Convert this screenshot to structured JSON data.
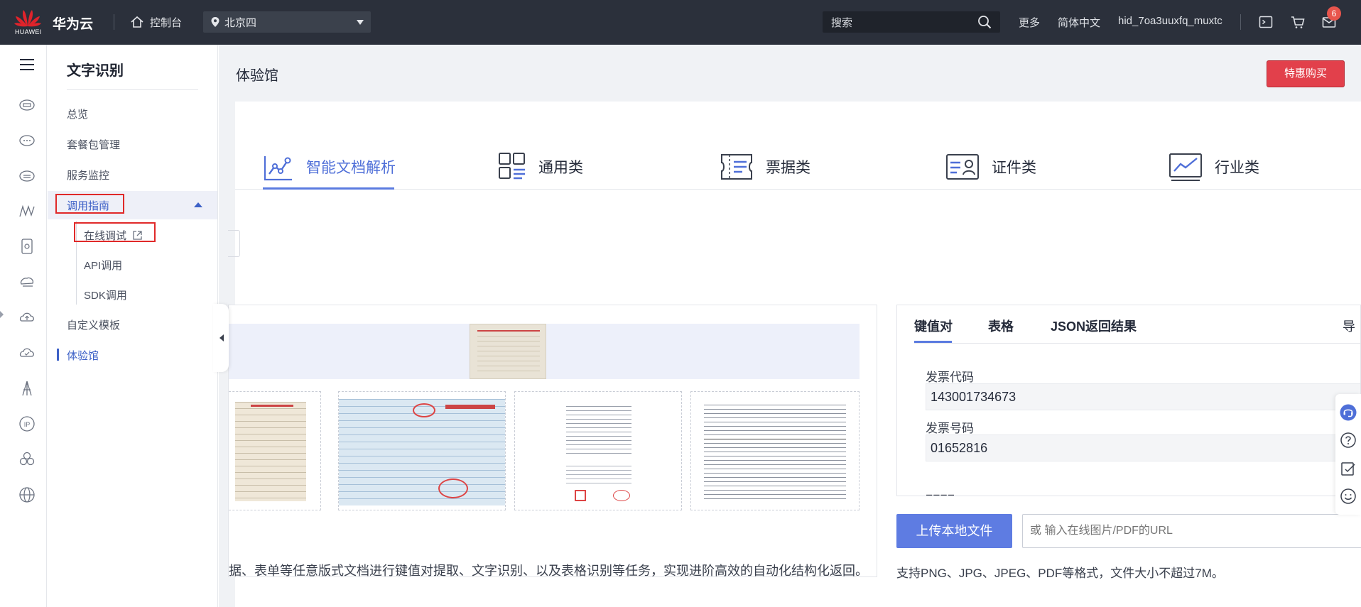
{
  "topbar": {
    "logo_text": "HUAWEI",
    "brand": "华为云",
    "console": "控制台",
    "region": "北京四",
    "search_placeholder": "搜索",
    "more": "更多",
    "language": "简体中文",
    "username": "hid_7oa3uuxfq_muxtc",
    "notification_count": "6",
    "logo_color": "#e0232b"
  },
  "rail": {
    "icons": [
      "menu-icon",
      "cloud-server-icon",
      "cloud-chat-icon",
      "cloud-storage-icon",
      "mountains-icon",
      "device-icon",
      "cloud-stack-icon",
      "cloud-up-icon",
      "cloud-check-icon",
      "tower-icon",
      "ip-icon",
      "cluster-icon",
      "globe-icon"
    ]
  },
  "subnav": {
    "title": "文字识别",
    "items": {
      "overview": "总览",
      "packages": "套餐包管理",
      "monitor": "服务监控",
      "guide": "调用指南",
      "online_debug": "在线调试",
      "api_call": "API调用",
      "sdk_call": "SDK调用",
      "custom_template": "自定义模板",
      "experience": "体验馆"
    }
  },
  "main": {
    "page_title": "体验馆",
    "buy_button": "特惠购买",
    "tabs": [
      {
        "label": "智能文档解析",
        "icon": "chart-doc-icon"
      },
      {
        "label": "通用类",
        "icon": "grid-apps-icon"
      },
      {
        "label": "票据类",
        "icon": "ticket-icon"
      },
      {
        "label": "证件类",
        "icon": "id-card-icon"
      },
      {
        "label": "行业类",
        "icon": "trend-chart-icon"
      }
    ],
    "description": "据、表单等任意版式文档进行键值对提取、文字识别、以及表格识别等任务，实现进阶高效的自动化结构化返回。",
    "result_tabs": {
      "kv": "键值对",
      "table": "表格",
      "json": "JSON返回结果",
      "export": "导"
    },
    "fields": [
      {
        "label": "发票代码",
        "value": "143001734673"
      },
      {
        "label": "发票号码",
        "value": "01652816"
      }
    ],
    "upload_button": "上传本地文件",
    "url_placeholder": "或 输入在线图片/PDF的URL",
    "formats_note": "支持PNG、JPG、JPEG、PDF等格式，文件大小不超过7M。"
  },
  "colors": {
    "accent": "#5b7be0",
    "buy": "#e2404b",
    "highlight_box": "#e02929"
  }
}
